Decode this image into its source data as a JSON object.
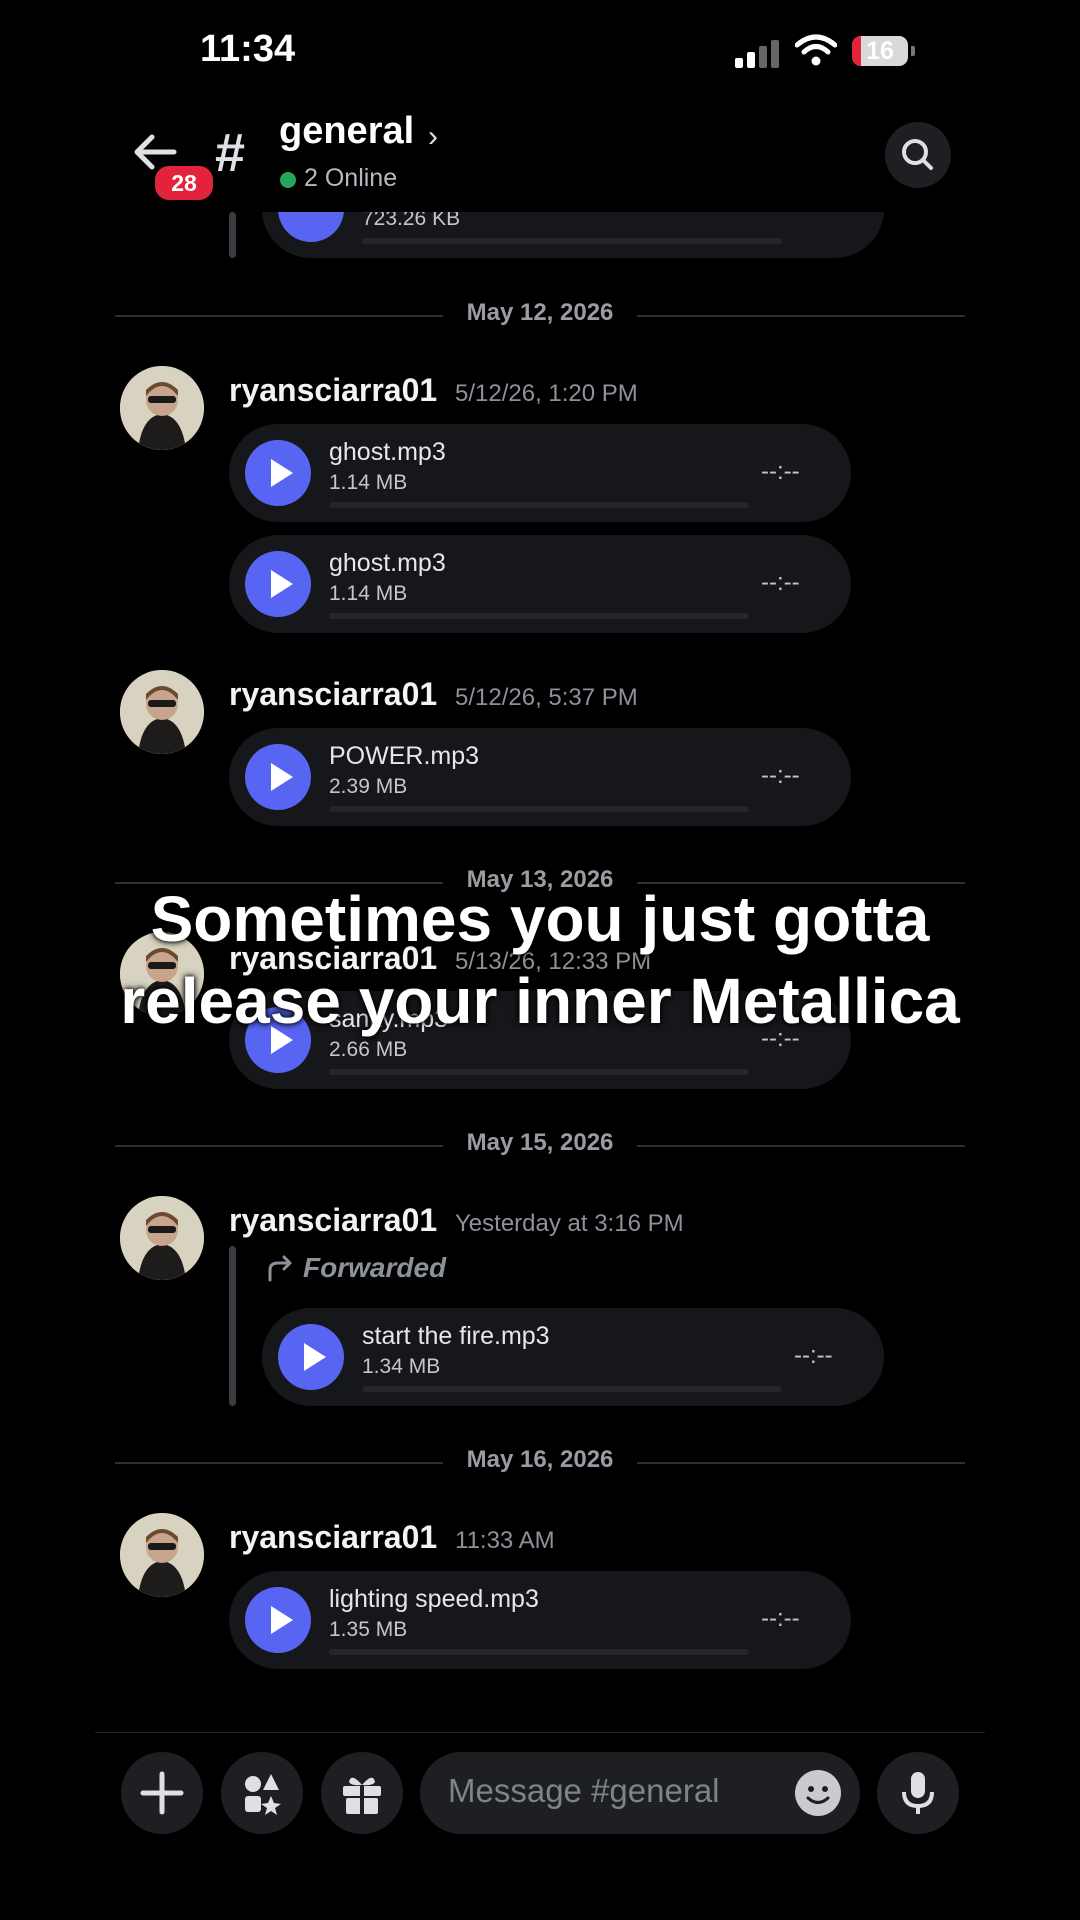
{
  "status_bar": {
    "time": "11:34",
    "battery": "16",
    "battery_level_percent": 16
  },
  "header": {
    "back_badge": "28",
    "channel_name": "general",
    "online_text": "2 Online"
  },
  "top_partial": {
    "file_size": "723.26 KB"
  },
  "overlay_caption": {
    "line1": "Sometimes you just gotta",
    "line2": "release your inner Metallica"
  },
  "dates": [
    "May 12, 2026",
    "May 13, 2026",
    "May 15, 2026",
    "May 16, 2026"
  ],
  "messages": [
    {
      "username": "ryansciarra01",
      "timestamp": "5/12/26, 1:20 PM",
      "attachments": [
        {
          "name": "ghost.mp3",
          "size": "1.14 MB",
          "duration": "--:--"
        },
        {
          "name": "ghost.mp3",
          "size": "1.14 MB",
          "duration": "--:--"
        }
      ]
    },
    {
      "username": "ryansciarra01",
      "timestamp": "5/12/26, 5:37 PM",
      "attachments": [
        {
          "name": "POWER.mp3",
          "size": "2.39 MB",
          "duration": "--:--"
        }
      ]
    },
    {
      "username": "ryansciarra01",
      "timestamp": "5/13/26, 12:33 PM",
      "attachments": [
        {
          "name": "sanity.mp3",
          "size": "2.66 MB",
          "duration": "--:--"
        }
      ]
    },
    {
      "username": "ryansciarra01",
      "timestamp": "Yesterday at 3:16 PM",
      "forwarded_label": "Forwarded",
      "attachments": [
        {
          "name": "start the fire.mp3",
          "size": "1.34 MB",
          "duration": "--:--"
        }
      ]
    },
    {
      "username": "ryansciarra01",
      "timestamp": "11:33 AM",
      "attachments": [
        {
          "name": "lighting speed.mp3",
          "size": "1.35 MB",
          "duration": "--:--"
        }
      ]
    }
  ],
  "composer": {
    "placeholder": "Message #general"
  },
  "colors": {
    "accent": "#5865f2",
    "badge": "#e2233b",
    "online": "#23a55a",
    "background": "#000000"
  }
}
